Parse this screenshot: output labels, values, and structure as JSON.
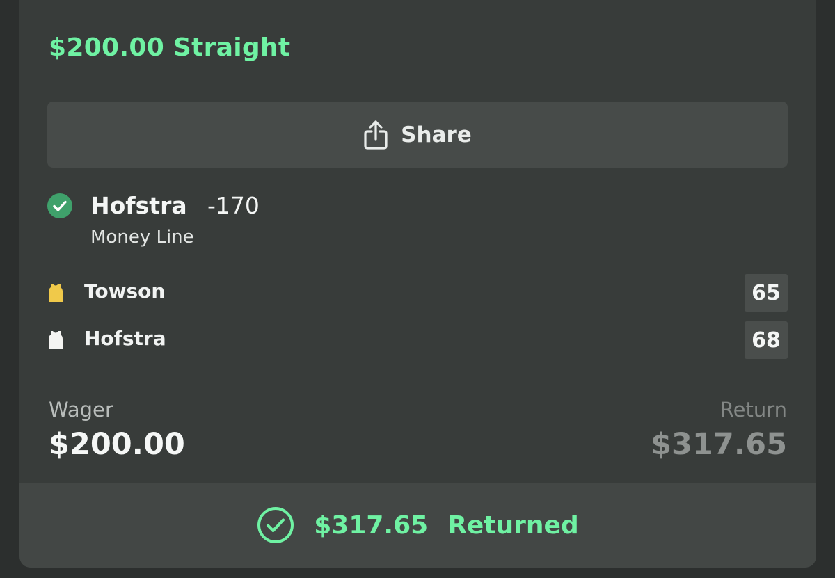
{
  "bet": {
    "title": "$200.00 Straight",
    "share_label": "Share",
    "pick": {
      "team": "Hofstra",
      "odds": "-170",
      "market": "Money Line"
    },
    "teams": [
      {
        "name": "Towson",
        "score": "65",
        "jersey_color": "#f0c94a"
      },
      {
        "name": "Hofstra",
        "score": "68",
        "jersey_color": "#f4f4f2"
      }
    ],
    "wager_label": "Wager",
    "wager_value": "$200.00",
    "return_label": "Return",
    "return_value": "$317.65",
    "result_amount": "$317.65",
    "result_status": "Returned"
  },
  "colors": {
    "accent": "#6ff2a3",
    "check_badge": "#3fa16b"
  },
  "icons": {
    "share": "share-icon",
    "win": "check-circle-icon",
    "result": "check-circle-outline-icon",
    "jersey": "jersey-icon"
  }
}
